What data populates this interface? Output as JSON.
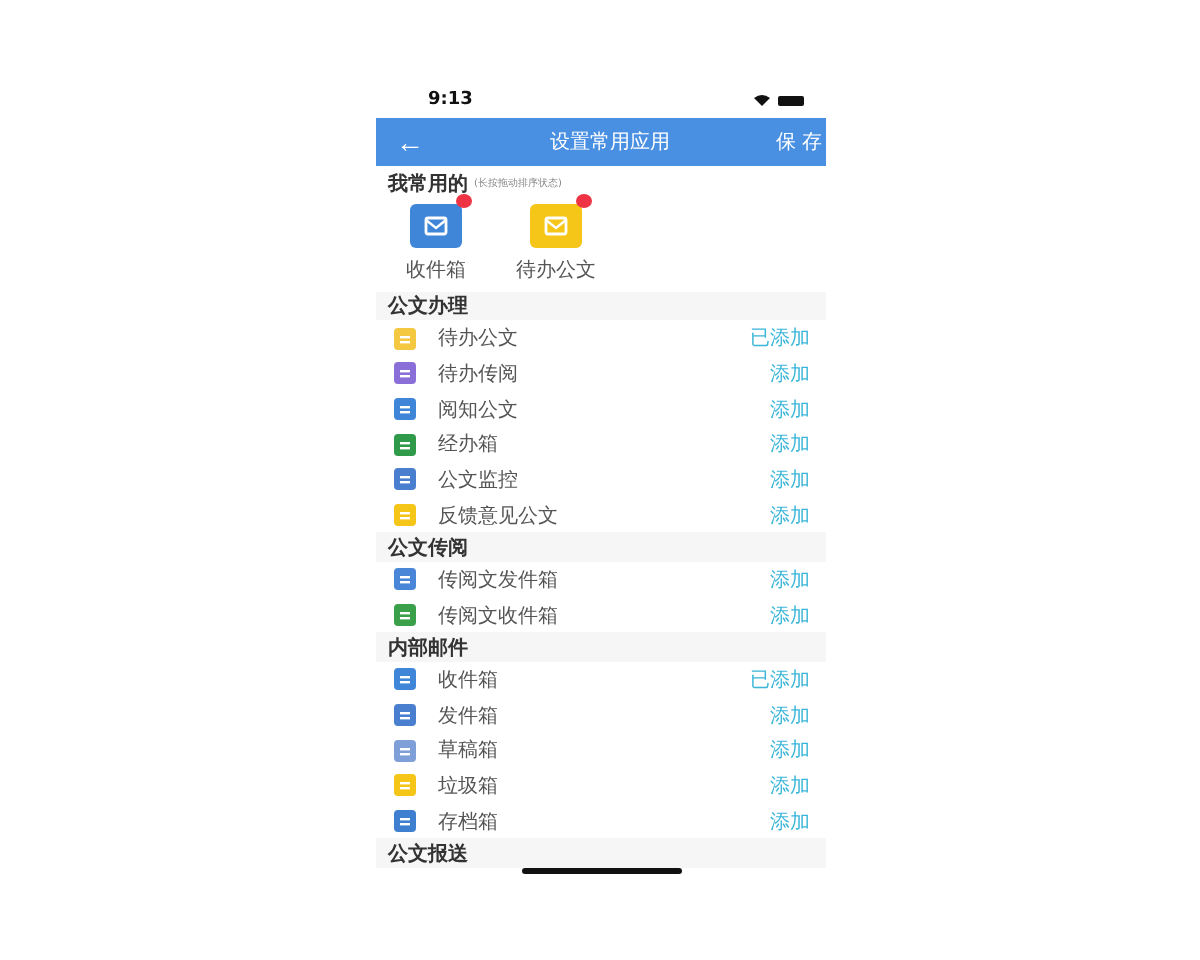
{
  "status_bar": {
    "time": "9:13"
  },
  "header": {
    "back": "←",
    "title": "设置常用应用",
    "action": "保 存"
  },
  "favorites": {
    "title": "我常用的",
    "hint": "(长按拖动排序状态)",
    "items": [
      {
        "label": "收件箱",
        "color": "#3f86d8"
      },
      {
        "label": "待办公文",
        "color": "#f5c518"
      }
    ]
  },
  "sections": [
    {
      "title": "公文办理",
      "items": [
        {
          "label": "待办公文",
          "status": "已添加",
          "color": "#f5c842"
        },
        {
          "label": "待办传阅",
          "status": "添加",
          "color": "#8a6fd8"
        },
        {
          "label": "阅知公文",
          "status": "添加",
          "color": "#3f86d8"
        },
        {
          "label": "经办箱",
          "status": "添加",
          "color": "#2e9a4a"
        },
        {
          "label": "公文监控",
          "status": "添加",
          "color": "#4a7fd0"
        },
        {
          "label": "反馈意见公文",
          "status": "添加",
          "color": "#f5c518"
        }
      ]
    },
    {
      "title": "公文传阅",
      "items": [
        {
          "label": "传阅文发件箱",
          "status": "添加",
          "color": "#4a86d8"
        },
        {
          "label": "传阅文收件箱",
          "status": "添加",
          "color": "#3aa04a"
        }
      ]
    },
    {
      "title": "内部邮件",
      "items": [
        {
          "label": "收件箱",
          "status": "已添加",
          "color": "#3f86d8"
        },
        {
          "label": "发件箱",
          "status": "添加",
          "color": "#4a7fd0"
        },
        {
          "label": "草稿箱",
          "status": "添加",
          "color": "#7f9fd8"
        },
        {
          "label": "垃圾箱",
          "status": "添加",
          "color": "#f5c518"
        },
        {
          "label": "存档箱",
          "status": "添加",
          "color": "#3f7fd0"
        }
      ]
    },
    {
      "title": "公文报送"
    }
  ]
}
